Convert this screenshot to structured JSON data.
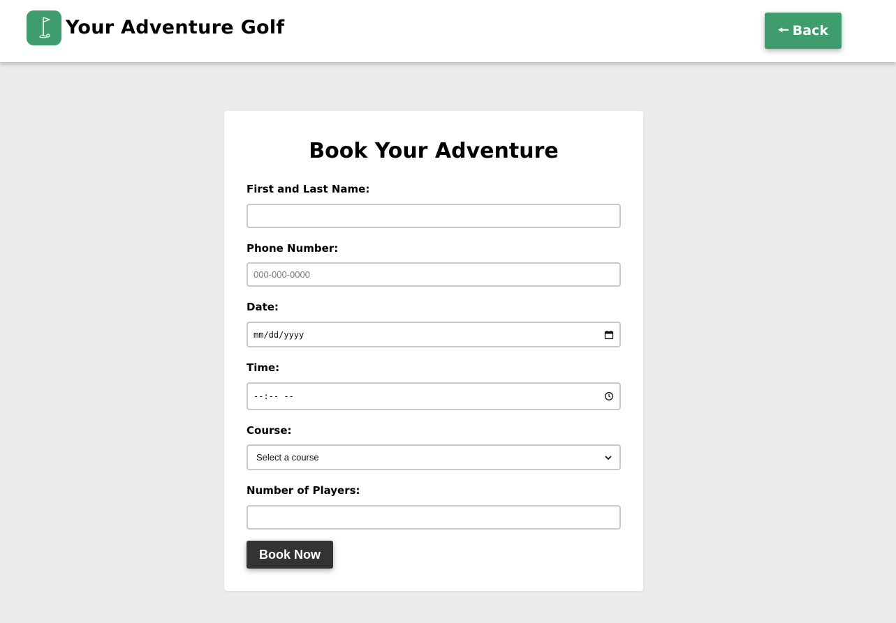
{
  "header": {
    "brand": "Your Adventure Golf",
    "back_label": "Back",
    "logo_icon": "golf-flag-icon",
    "back_icon": "arrow-left-icon"
  },
  "form": {
    "title": "Book Your Adventure",
    "name_label": "First and Last Name:",
    "name_value": "",
    "phone_label": "Phone Number:",
    "phone_placeholder": "000-000-0000",
    "date_label": "Date:",
    "date_placeholder": "mm/dd/yyyy",
    "time_label": "Time:",
    "time_placeholder": "--:-- --",
    "course_label": "Course:",
    "course_selected": "Select a course",
    "players_label": "Number of Players:",
    "players_value": "",
    "submit_label": "Book Now"
  },
  "colors": {
    "brand_green": "#3e9c6d",
    "page_bg": "#eaeceb",
    "button_dark": "#333333"
  }
}
